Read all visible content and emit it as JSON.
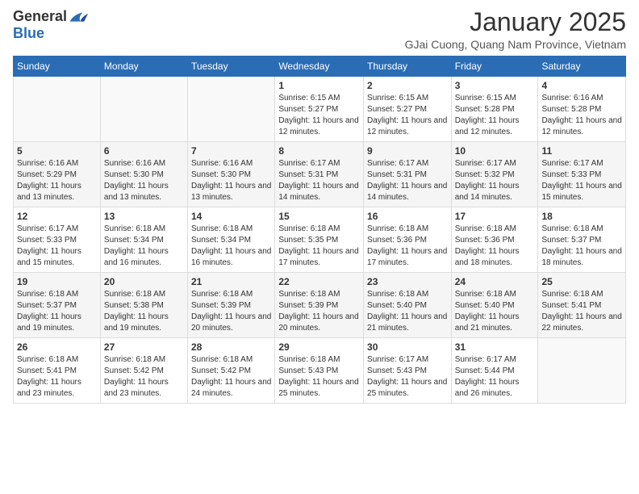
{
  "logo": {
    "general": "General",
    "blue": "Blue"
  },
  "title": "January 2025",
  "subtitle": "GJai Cuong, Quang Nam Province, Vietnam",
  "days_of_week": [
    "Sunday",
    "Monday",
    "Tuesday",
    "Wednesday",
    "Thursday",
    "Friday",
    "Saturday"
  ],
  "weeks": [
    [
      {
        "day": "",
        "info": ""
      },
      {
        "day": "",
        "info": ""
      },
      {
        "day": "",
        "info": ""
      },
      {
        "day": "1",
        "info": "Sunrise: 6:15 AM\nSunset: 5:27 PM\nDaylight: 11 hours and 12 minutes."
      },
      {
        "day": "2",
        "info": "Sunrise: 6:15 AM\nSunset: 5:27 PM\nDaylight: 11 hours and 12 minutes."
      },
      {
        "day": "3",
        "info": "Sunrise: 6:15 AM\nSunset: 5:28 PM\nDaylight: 11 hours and 12 minutes."
      },
      {
        "day": "4",
        "info": "Sunrise: 6:16 AM\nSunset: 5:28 PM\nDaylight: 11 hours and 12 minutes."
      }
    ],
    [
      {
        "day": "5",
        "info": "Sunrise: 6:16 AM\nSunset: 5:29 PM\nDaylight: 11 hours and 13 minutes."
      },
      {
        "day": "6",
        "info": "Sunrise: 6:16 AM\nSunset: 5:30 PM\nDaylight: 11 hours and 13 minutes."
      },
      {
        "day": "7",
        "info": "Sunrise: 6:16 AM\nSunset: 5:30 PM\nDaylight: 11 hours and 13 minutes."
      },
      {
        "day": "8",
        "info": "Sunrise: 6:17 AM\nSunset: 5:31 PM\nDaylight: 11 hours and 14 minutes."
      },
      {
        "day": "9",
        "info": "Sunrise: 6:17 AM\nSunset: 5:31 PM\nDaylight: 11 hours and 14 minutes."
      },
      {
        "day": "10",
        "info": "Sunrise: 6:17 AM\nSunset: 5:32 PM\nDaylight: 11 hours and 14 minutes."
      },
      {
        "day": "11",
        "info": "Sunrise: 6:17 AM\nSunset: 5:33 PM\nDaylight: 11 hours and 15 minutes."
      }
    ],
    [
      {
        "day": "12",
        "info": "Sunrise: 6:17 AM\nSunset: 5:33 PM\nDaylight: 11 hours and 15 minutes."
      },
      {
        "day": "13",
        "info": "Sunrise: 6:18 AM\nSunset: 5:34 PM\nDaylight: 11 hours and 16 minutes."
      },
      {
        "day": "14",
        "info": "Sunrise: 6:18 AM\nSunset: 5:34 PM\nDaylight: 11 hours and 16 minutes."
      },
      {
        "day": "15",
        "info": "Sunrise: 6:18 AM\nSunset: 5:35 PM\nDaylight: 11 hours and 17 minutes."
      },
      {
        "day": "16",
        "info": "Sunrise: 6:18 AM\nSunset: 5:36 PM\nDaylight: 11 hours and 17 minutes."
      },
      {
        "day": "17",
        "info": "Sunrise: 6:18 AM\nSunset: 5:36 PM\nDaylight: 11 hours and 18 minutes."
      },
      {
        "day": "18",
        "info": "Sunrise: 6:18 AM\nSunset: 5:37 PM\nDaylight: 11 hours and 18 minutes."
      }
    ],
    [
      {
        "day": "19",
        "info": "Sunrise: 6:18 AM\nSunset: 5:37 PM\nDaylight: 11 hours and 19 minutes."
      },
      {
        "day": "20",
        "info": "Sunrise: 6:18 AM\nSunset: 5:38 PM\nDaylight: 11 hours and 19 minutes."
      },
      {
        "day": "21",
        "info": "Sunrise: 6:18 AM\nSunset: 5:39 PM\nDaylight: 11 hours and 20 minutes."
      },
      {
        "day": "22",
        "info": "Sunrise: 6:18 AM\nSunset: 5:39 PM\nDaylight: 11 hours and 20 minutes."
      },
      {
        "day": "23",
        "info": "Sunrise: 6:18 AM\nSunset: 5:40 PM\nDaylight: 11 hours and 21 minutes."
      },
      {
        "day": "24",
        "info": "Sunrise: 6:18 AM\nSunset: 5:40 PM\nDaylight: 11 hours and 21 minutes."
      },
      {
        "day": "25",
        "info": "Sunrise: 6:18 AM\nSunset: 5:41 PM\nDaylight: 11 hours and 22 minutes."
      }
    ],
    [
      {
        "day": "26",
        "info": "Sunrise: 6:18 AM\nSunset: 5:41 PM\nDaylight: 11 hours and 23 minutes."
      },
      {
        "day": "27",
        "info": "Sunrise: 6:18 AM\nSunset: 5:42 PM\nDaylight: 11 hours and 23 minutes."
      },
      {
        "day": "28",
        "info": "Sunrise: 6:18 AM\nSunset: 5:42 PM\nDaylight: 11 hours and 24 minutes."
      },
      {
        "day": "29",
        "info": "Sunrise: 6:18 AM\nSunset: 5:43 PM\nDaylight: 11 hours and 25 minutes."
      },
      {
        "day": "30",
        "info": "Sunrise: 6:17 AM\nSunset: 5:43 PM\nDaylight: 11 hours and 25 minutes."
      },
      {
        "day": "31",
        "info": "Sunrise: 6:17 AM\nSunset: 5:44 PM\nDaylight: 11 hours and 26 minutes."
      },
      {
        "day": "",
        "info": ""
      }
    ]
  ]
}
